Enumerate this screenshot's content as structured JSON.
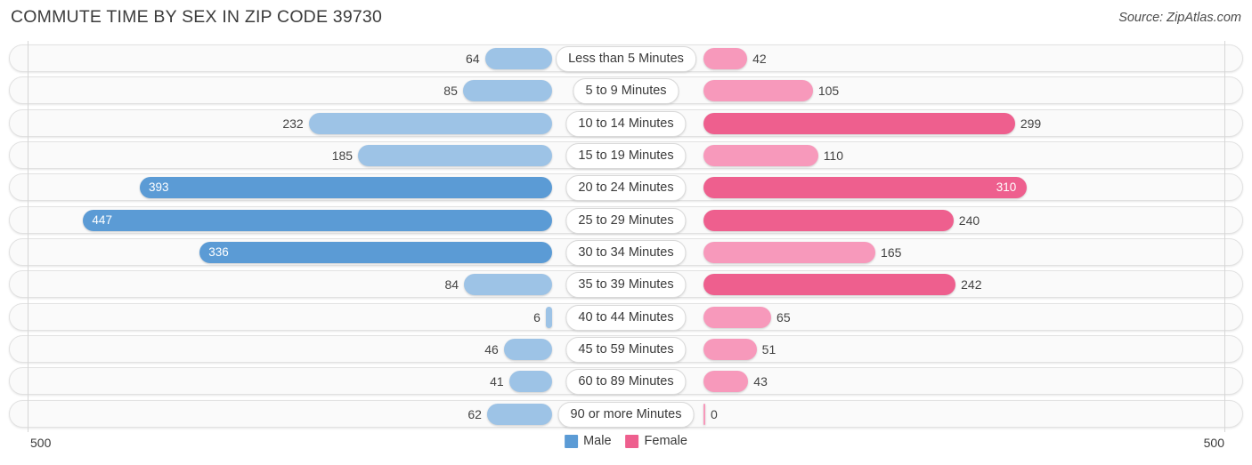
{
  "header": {
    "title": "COMMUTE TIME BY SEX IN ZIP CODE 39730",
    "source": "Source: ZipAtlas.com"
  },
  "footer": {
    "axis_left": "500",
    "axis_right": "500",
    "legend": [
      {
        "label": "Male",
        "color": "#5b9bd5"
      },
      {
        "label": "Female",
        "color": "#ee5f8e"
      }
    ]
  },
  "colors": {
    "male_light": "#9dc3e6",
    "male_dark": "#5b9bd5",
    "female_light": "#f799bb",
    "female_dark": "#ee5f8e",
    "row_background": "#fafafa",
    "row_border": "#e2e2e2",
    "gridline": "#d6d6d6"
  },
  "chart_data": {
    "type": "bar",
    "title": "COMMUTE TIME BY SEX IN ZIP CODE 39730",
    "subtitle": "",
    "orientation": "horizontal",
    "style": "diverging-bidirectional",
    "xlabel": "",
    "ylabel": "",
    "xlim": [
      500,
      500
    ],
    "axis_max": 500,
    "grid": true,
    "legend_position": "bottom-center",
    "categories": [
      "Less than 5 Minutes",
      "5 to 9 Minutes",
      "10 to 14 Minutes",
      "15 to 19 Minutes",
      "20 to 24 Minutes",
      "25 to 29 Minutes",
      "30 to 34 Minutes",
      "35 to 39 Minutes",
      "40 to 44 Minutes",
      "45 to 59 Minutes",
      "60 to 89 Minutes",
      "90 or more Minutes"
    ],
    "series": [
      {
        "name": "Male",
        "side": "left",
        "values": [
          64,
          85,
          232,
          185,
          393,
          447,
          336,
          84,
          6,
          46,
          41,
          62
        ]
      },
      {
        "name": "Female",
        "side": "right",
        "values": [
          42,
          105,
          299,
          110,
          310,
          240,
          165,
          242,
          65,
          51,
          43,
          0
        ]
      }
    ],
    "rows": [
      {
        "category": "Less than 5 Minutes",
        "male": 64,
        "male_text": "64",
        "male_inside": false,
        "male_shade": "light",
        "female": 42,
        "female_text": "42",
        "female_inside": false,
        "female_shade": "light"
      },
      {
        "category": "5 to 9 Minutes",
        "male": 85,
        "male_text": "85",
        "male_inside": false,
        "male_shade": "light",
        "female": 105,
        "female_text": "105",
        "female_inside": false,
        "female_shade": "light"
      },
      {
        "category": "10 to 14 Minutes",
        "male": 232,
        "male_text": "232",
        "male_inside": false,
        "male_shade": "light",
        "female": 299,
        "female_text": "299",
        "female_inside": false,
        "female_shade": "dark"
      },
      {
        "category": "15 to 19 Minutes",
        "male": 185,
        "male_text": "185",
        "male_inside": false,
        "male_shade": "light",
        "female": 110,
        "female_text": "110",
        "female_inside": false,
        "female_shade": "light"
      },
      {
        "category": "20 to 24 Minutes",
        "male": 393,
        "male_text": "393",
        "male_inside": true,
        "male_shade": "dark",
        "female": 310,
        "female_text": "310",
        "female_inside": true,
        "female_shade": "dark"
      },
      {
        "category": "25 to 29 Minutes",
        "male": 447,
        "male_text": "447",
        "male_inside": true,
        "male_shade": "dark",
        "female": 240,
        "female_text": "240",
        "female_inside": false,
        "female_shade": "dark"
      },
      {
        "category": "30 to 34 Minutes",
        "male": 336,
        "male_text": "336",
        "male_inside": true,
        "male_shade": "dark",
        "female": 165,
        "female_text": "165",
        "female_inside": false,
        "female_shade": "light"
      },
      {
        "category": "35 to 39 Minutes",
        "male": 84,
        "male_text": "84",
        "male_inside": false,
        "male_shade": "light",
        "female": 242,
        "female_text": "242",
        "female_inside": false,
        "female_shade": "dark"
      },
      {
        "category": "40 to 44 Minutes",
        "male": 6,
        "male_text": "6",
        "male_inside": false,
        "male_shade": "light",
        "female": 65,
        "female_text": "65",
        "female_inside": false,
        "female_shade": "light"
      },
      {
        "category": "45 to 59 Minutes",
        "male": 46,
        "male_text": "46",
        "male_inside": false,
        "male_shade": "light",
        "female": 51,
        "female_text": "51",
        "female_inside": false,
        "female_shade": "light"
      },
      {
        "category": "60 to 89 Minutes",
        "male": 41,
        "male_text": "41",
        "male_inside": false,
        "male_shade": "light",
        "female": 43,
        "female_text": "43",
        "female_inside": false,
        "female_shade": "light"
      },
      {
        "category": "90 or more Minutes",
        "male": 62,
        "male_text": "62",
        "male_inside": false,
        "male_shade": "light",
        "female": 0,
        "female_text": "0",
        "female_inside": false,
        "female_shade": "light"
      }
    ]
  }
}
